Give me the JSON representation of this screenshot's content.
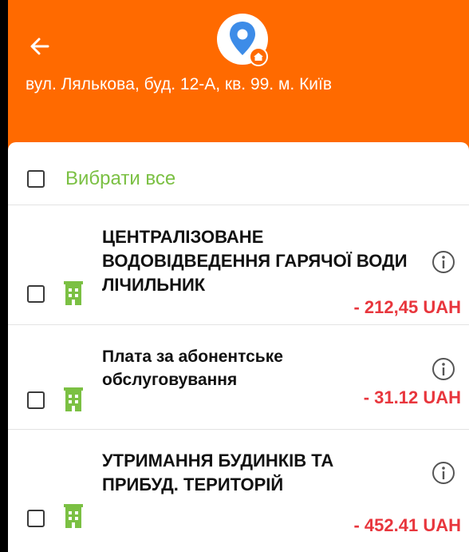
{
  "header": {
    "address": "вул. Ляльковa, буд. 12-А, кв. 99. м. Київ",
    "accent_color": "#ff6a00",
    "back_icon": "arrow-left-icon",
    "logo_icon": "map-pin-home-icon"
  },
  "select_all": {
    "label": "Вибрати все",
    "checked": false
  },
  "items": [
    {
      "title": "ЦЕНТРАЛІЗОВАНЕ ВОДОВІДВЕДЕННЯ ГАРЯЧОЇ ВОДИ ЛІЧИЛЬНИК",
      "amount": "- 212,45  UAH",
      "checked": false,
      "icon": "building-icon"
    },
    {
      "title": "Плата за абонентське обслуговування",
      "amount": "- 31.12  UAH",
      "checked": false,
      "icon": "building-icon"
    },
    {
      "title": "УТРИМАННЯ БУДИНКІВ ТА ПРИБУД. ТЕРИТОРІЙ",
      "amount": "- 452.41  UAH",
      "checked": false,
      "icon": "building-icon"
    }
  ],
  "colors": {
    "select_all_text": "#7bc043",
    "amount_text": "#e8363d",
    "building_icon": "#7bc043"
  }
}
